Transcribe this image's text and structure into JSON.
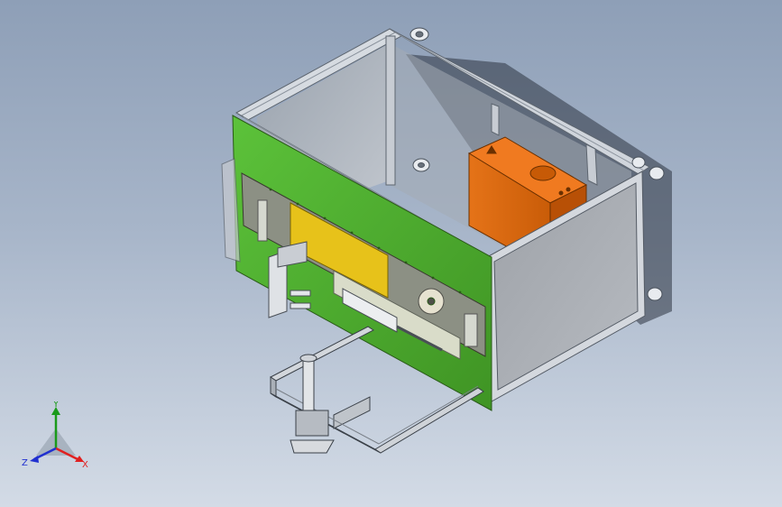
{
  "viewport": {
    "background_top": "#8e9fb7",
    "background_bottom": "#d3dbe6"
  },
  "model": {
    "frame_color": "#c9ced6",
    "panel_green": "#4cae2f",
    "orange_block": "#e06a10",
    "yellow_panel": "#e7c21a",
    "glass_color": "#b4bac3"
  },
  "triad": {
    "x_label": "X",
    "y_label": "Y",
    "z_label": "Z",
    "x_color": "#e02020",
    "y_color": "#1a9a1a",
    "z_color": "#2030d0"
  }
}
